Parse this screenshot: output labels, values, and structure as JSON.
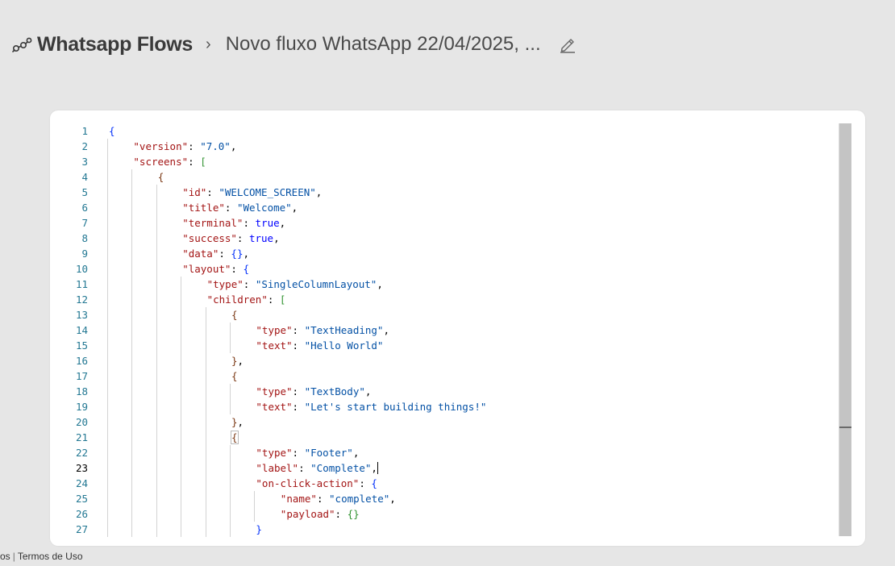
{
  "header": {
    "brand": "Whatsapp Flows",
    "separator": "›",
    "flow_title": "Novo fluxo WhatsApp 22/04/2025, ..."
  },
  "editor": {
    "cursor_line": 23,
    "lines": [
      "{",
      "    \"version\": \"7.0\",",
      "    \"screens\": [",
      "        {",
      "            \"id\": \"WELCOME_SCREEN\",",
      "            \"title\": \"Welcome\",",
      "            \"terminal\": true,",
      "            \"success\": true,",
      "            \"data\": {},",
      "            \"layout\": {",
      "                \"type\": \"SingleColumnLayout\",",
      "                \"children\": [",
      "                    {",
      "                        \"type\": \"TextHeading\",",
      "                        \"text\": \"Hello World\"",
      "                    },",
      "                    {",
      "                        \"type\": \"TextBody\",",
      "                        \"text\": \"Let's start building things!\"",
      "                    },",
      "                    {",
      "                        \"type\": \"Footer\",",
      "                        \"label\": \"Complete\",",
      "                        \"on-click-action\": {",
      "                            \"name\": \"complete\",",
      "                            \"payload\": {}",
      "                        }"
    ]
  },
  "footer": {
    "partial_link": "os",
    "divider": "|",
    "terms": "Termos de Uso"
  }
}
